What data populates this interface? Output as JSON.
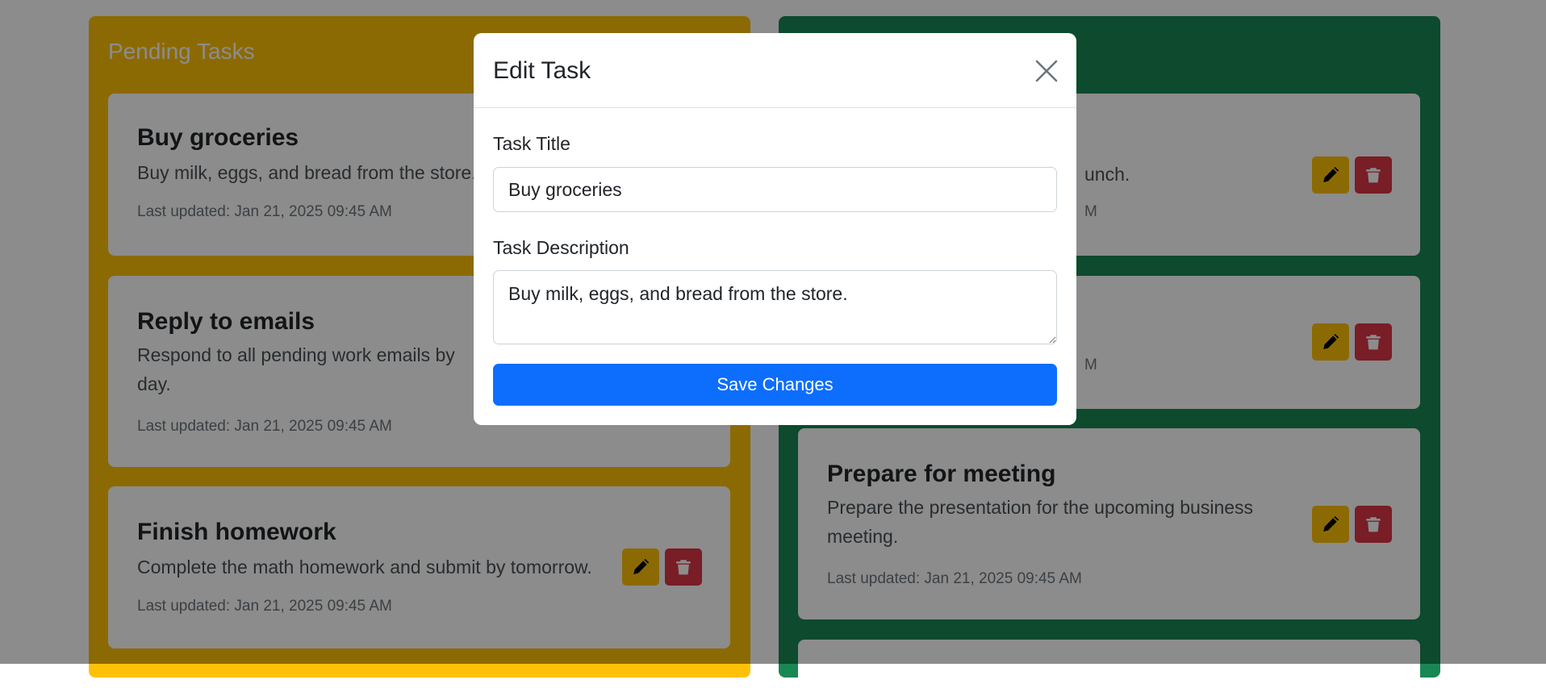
{
  "columns": {
    "pending": {
      "title": "Pending Tasks",
      "color": "#ffc107",
      "tasks": [
        {
          "title": "Buy groceries",
          "description": "Buy milk, eggs, and bread from the store.",
          "updated": "Last updated: Jan 21, 2025 09:45 AM"
        },
        {
          "title": "Reply to emails",
          "description_line1": "Respond to all pending work emails by",
          "description_line2": "day.",
          "updated": "Last updated: Jan 21, 2025 09:45 AM"
        },
        {
          "title": "Finish homework",
          "description": "Complete the math homework and submit by tomorrow.",
          "updated": "Last updated: Jan 21, 2025 09:45 AM"
        }
      ]
    },
    "completed": {
      "color": "#198754",
      "tasks": [
        {
          "description_fragment": "unch.",
          "updated_fragment": "M"
        },
        {
          "updated_fragment": "M"
        },
        {
          "title": "Prepare for meeting",
          "description_line1": "Prepare the presentation for the upcoming business",
          "description_line2": "meeting.",
          "updated": "Last updated: Jan 21, 2025 09:45 AM"
        }
      ]
    }
  },
  "icons": {
    "edit": "pencil-icon",
    "delete": "trash-icon",
    "close": "close-icon"
  },
  "modal": {
    "title": "Edit Task",
    "title_label": "Task Title",
    "title_value": "Buy groceries",
    "description_label": "Task Description",
    "description_value": "Buy milk, eggs, and bread from the store.",
    "save_label": "Save Changes",
    "save_color": "#0d6efd"
  }
}
